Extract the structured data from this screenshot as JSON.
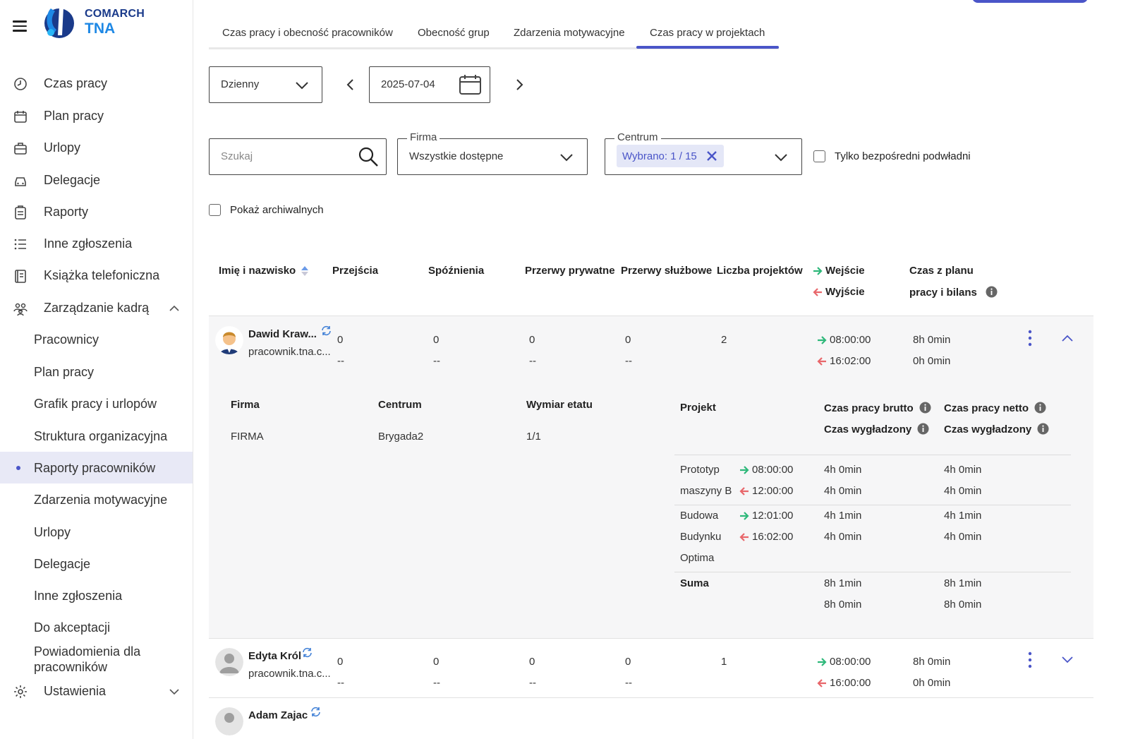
{
  "app": {
    "brand": "COMARCH",
    "product": "TNA"
  },
  "sidebar": {
    "items": [
      {
        "label": "Czas pracy",
        "icon": "clock-icon"
      },
      {
        "label": "Plan pracy",
        "icon": "calendar-icon"
      },
      {
        "label": "Urlopy",
        "icon": "suitcase-icon"
      },
      {
        "label": "Delegacje",
        "icon": "car-icon"
      },
      {
        "label": "Raporty",
        "icon": "clipboard-icon"
      },
      {
        "label": "Inne zgłoszenia",
        "icon": "list-icon"
      },
      {
        "label": "Książka telefoniczna",
        "icon": "phonebook-icon"
      },
      {
        "label": "Zarządzanie kadrą",
        "icon": "people-icon"
      }
    ],
    "subitems": [
      "Pracownicy",
      "Plan pracy",
      "Grafik pracy i urlopów",
      "Struktura organizacyjna",
      "Raporty pracowników",
      "Zdarzenia motywacyjne",
      "Urlopy",
      "Delegacje",
      "Inne zgłoszenia",
      "Do akceptacji",
      "Powiadomienia dla",
      "pracowników"
    ],
    "settings": "Ustawienia"
  },
  "tabs": [
    "Czas pracy i obecność pracowników",
    "Obecność grup",
    "Zdarzenia motywacyjne",
    "Czas pracy w projektach"
  ],
  "filters": {
    "period": "Dzienny",
    "date": "2025-07-04",
    "search_placeholder": "Szukaj",
    "firma_label": "Firma",
    "firma_value": "Wszystkie dostępne",
    "centrum_label": "Centrum",
    "centrum_chip": "Wybrano: 1 / 15",
    "only_direct": "Tylko bezpośredni podwładni",
    "show_archived": "Pokaż archiwalnych"
  },
  "table": {
    "headers": {
      "name": "Imię i nazwisko",
      "przejscia": "Przejścia",
      "spoznienia": "Spóźnienia",
      "przerwy_prywatne": "Przerwy prywatne",
      "przerwy_sluzbowe": "Przerwy służbowe",
      "liczba_projektow": "Liczba projektów",
      "wejscie": "Wejście",
      "wyjscie": "Wyjście",
      "czas_line1": "Czas z planu",
      "czas_line2": "pracy i bilans"
    },
    "rows": [
      {
        "name": "Dawid Kraw...",
        "email": "pracownik.tna.c...",
        "przejscia": "0",
        "przejscia2": "--",
        "spoznienia": "0",
        "spoznienia2": "--",
        "pp": "0",
        "pp2": "--",
        "ps": "0",
        "ps2": "--",
        "projekty": "2",
        "in": "08:00:00",
        "out": "16:02:00",
        "plan": "8h 0min",
        "bilans": "0h 0min"
      },
      {
        "name": "Edyta Król",
        "email": "pracownik.tna.c...",
        "przejscia": "0",
        "przejscia2": "--",
        "spoznienia": "0",
        "spoznienia2": "--",
        "pp": "0",
        "pp2": "--",
        "ps": "0",
        "ps2": "--",
        "projekty": "1",
        "in": "08:00:00",
        "out": "16:00:00",
        "plan": "8h 0min",
        "bilans": "0h 0min"
      },
      {
        "name": "Adam Zajac"
      }
    ]
  },
  "details": {
    "firma_label": "Firma",
    "centrum_label": "Centrum",
    "wymiar_label": "Wymiar etatu",
    "firma": "FIRMA",
    "centrum": "Brygada2",
    "wymiar": "1/1",
    "projekt_label": "Projekt",
    "brutto_label": "Czas pracy brutto",
    "netto_label": "Czas pracy netto",
    "wygladzony_label": "Czas wygładzony",
    "projects": [
      {
        "name1": "Prototyp",
        "name2": "maszyny B",
        "name3": "",
        "in": "08:00:00",
        "out": "12:00:00",
        "brutto": "4h 0min",
        "brutto2": "4h 0min",
        "netto": "4h 0min",
        "netto2": "4h 0min"
      },
      {
        "name1": "Budowa",
        "name2": "Budynku",
        "name3": "Optima",
        "in": "12:01:00",
        "out": "16:02:00",
        "brutto": "4h 1min",
        "brutto2": "4h 0min",
        "netto": "4h 1min",
        "netto2": "4h 0min"
      }
    ],
    "suma_label": "Suma",
    "suma_brutto": "8h 1min",
    "suma_brutto2": "8h 0min",
    "suma_netto": "8h 1min",
    "suma_netto2": "8h 0min"
  },
  "colors": {
    "accent": "#4a55c8",
    "arrow_in": "#2eb87a",
    "arrow_out": "#e8676b"
  }
}
